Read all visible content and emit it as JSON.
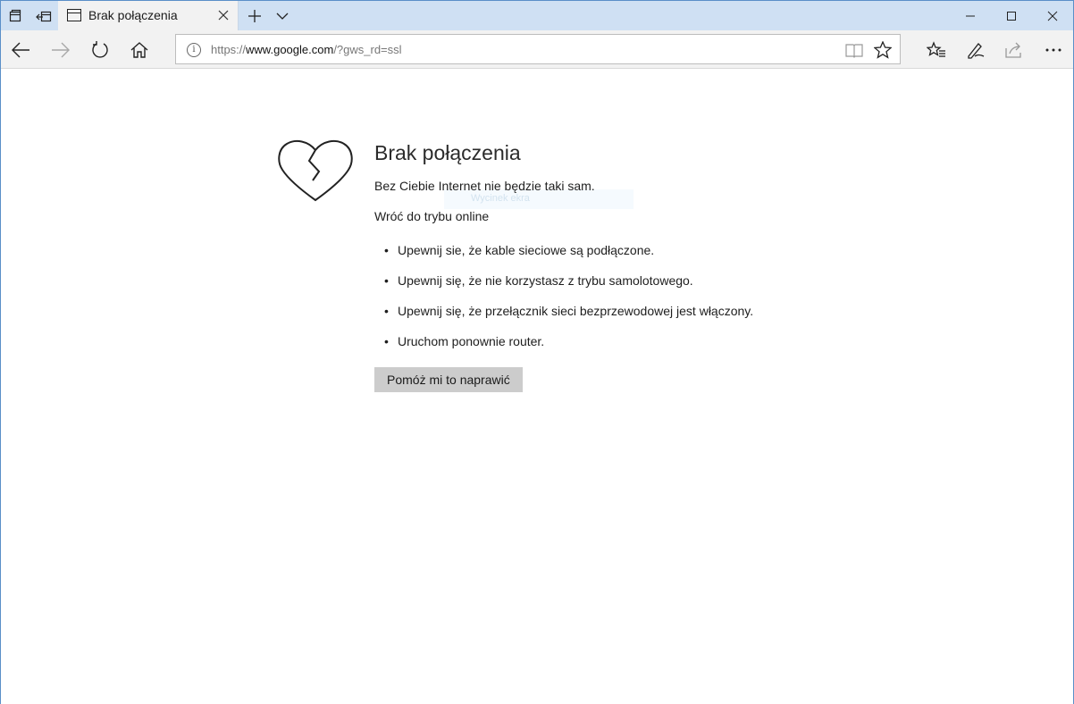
{
  "tab": {
    "title": "Brak połączenia"
  },
  "address": {
    "scheme": "https://",
    "host": "www.google.com",
    "path": "/?gws_rd=ssl"
  },
  "error": {
    "title": "Brak połączenia",
    "subtitle": "Bez Ciebie Internet nie będzie taki sam.",
    "section": "Wróć do trybu online",
    "tips": [
      "Upewnij sie, że kable sieciowe są podłączone.",
      "Upewnij się, że nie korzystasz z trybu samolotowego.",
      "Upewnij się, że przełącznik sieci bezprzewodowej jest włączony.",
      "Uruchom ponownie router."
    ],
    "button": "Pomóż mi to naprawić"
  },
  "ghost_text": "Wycinek ekra",
  "colors": {
    "tabstrip": "#cfe0f3",
    "toolbar": "#f2f2f2",
    "button": "#cccccc",
    "border": "#5a8fc8"
  }
}
